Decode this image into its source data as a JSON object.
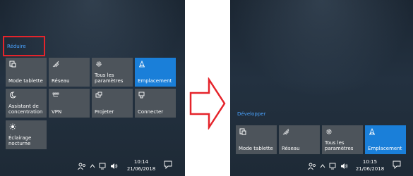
{
  "before": {
    "collapse_label": "Réduire",
    "tiles": [
      {
        "label": "Mode tablette",
        "icon": "tablet-mode-icon",
        "active": false
      },
      {
        "label": "Réseau",
        "icon": "network-icon",
        "active": false
      },
      {
        "label": "Tous les paramètres",
        "icon": "settings-gear-icon",
        "active": false
      },
      {
        "label": "Emplacement",
        "icon": "location-icon",
        "active": true
      },
      {
        "label": "Assistant de concentration",
        "icon": "moon-icon",
        "active": false
      },
      {
        "label": "VPN",
        "icon": "vpn-icon",
        "active": false
      },
      {
        "label": "Projeter",
        "icon": "project-icon",
        "active": false
      },
      {
        "label": "Connecter",
        "icon": "connect-icon",
        "active": false
      },
      {
        "label": "Éclairage nocturne",
        "icon": "sun-icon",
        "active": false
      }
    ],
    "clock": {
      "time": "10:14",
      "date": "21/06/2018"
    }
  },
  "after": {
    "expand_label": "Développer",
    "tiles": [
      {
        "label": "Mode tablette",
        "icon": "tablet-mode-icon",
        "active": false
      },
      {
        "label": "Réseau",
        "icon": "network-icon",
        "active": false
      },
      {
        "label": "Tous les paramètres",
        "icon": "settings-gear-icon",
        "active": false
      },
      {
        "label": "Emplacement",
        "icon": "location-icon",
        "active": true
      }
    ],
    "clock": {
      "time": "10:15",
      "date": "21/06/2018"
    }
  },
  "colors": {
    "accent": "#1a7fd9",
    "tile": "#4d545b",
    "highlight": "#e5242b",
    "link": "#4aa3ff"
  }
}
